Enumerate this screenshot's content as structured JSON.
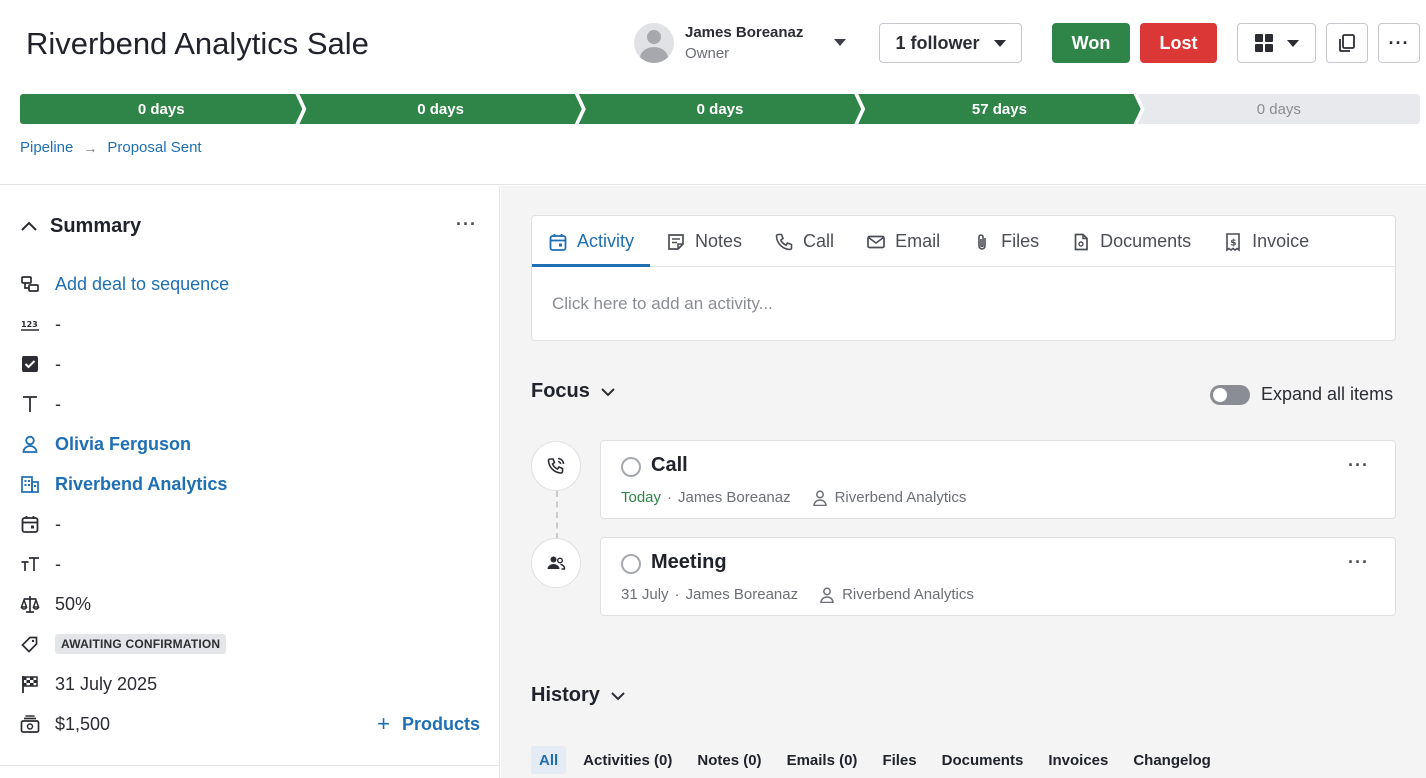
{
  "deal": {
    "title": "Riverbend Analytics Sale"
  },
  "owner": {
    "name": "James Boreanaz",
    "role": "Owner"
  },
  "actions": {
    "follower_label": "1 follower",
    "won_label": "Won",
    "lost_label": "Lost",
    "more_label": "···"
  },
  "pipeline": {
    "stages": [
      {
        "label": "0 days",
        "status": "done"
      },
      {
        "label": "0 days",
        "status": "done"
      },
      {
        "label": "0 days",
        "status": "done"
      },
      {
        "label": "57 days",
        "status": "done"
      },
      {
        "label": "0 days",
        "status": "todo"
      }
    ]
  },
  "breadcrumb": {
    "root": "Pipeline",
    "arrow": "→",
    "current": "Proposal Sent"
  },
  "summary": {
    "title": "Summary",
    "more": "···",
    "sequence_link": "Add deal to sequence",
    "number_field": "-",
    "checkbox_field": "-",
    "text_field": "-",
    "person": "Olivia Ferguson",
    "organization": "Riverbend Analytics",
    "date_field": "-",
    "large_text_field": "-",
    "probability": "50%",
    "label_badge": "AWAITING CONFIRMATION",
    "expected_close": "31 July 2025",
    "value": "$1,500",
    "products_label": "Products",
    "products_plus": "+"
  },
  "composer": {
    "tabs": [
      "Activity",
      "Notes",
      "Call",
      "Email",
      "Files",
      "Documents",
      "Invoice"
    ],
    "placeholder": "Click here to add an activity..."
  },
  "focus": {
    "title": "Focus",
    "expand_label": "Expand all items"
  },
  "activities": [
    {
      "title": "Call",
      "date": "Today",
      "sep": "·",
      "owner": "James Boreanaz",
      "org": "Riverbend Analytics",
      "more": "···"
    },
    {
      "title": "Meeting",
      "date": "31 July",
      "sep": "·",
      "owner": "James Boreanaz",
      "org": "Riverbend Analytics",
      "more": "···"
    }
  ],
  "history": {
    "title": "History",
    "filters": [
      "All",
      "Activities (0)",
      "Notes (0)",
      "Emails (0)",
      "Files",
      "Documents",
      "Invoices",
      "Changelog"
    ]
  },
  "colors": {
    "green": "#2f8547",
    "red": "#db3737",
    "link": "#1f6fb4"
  }
}
